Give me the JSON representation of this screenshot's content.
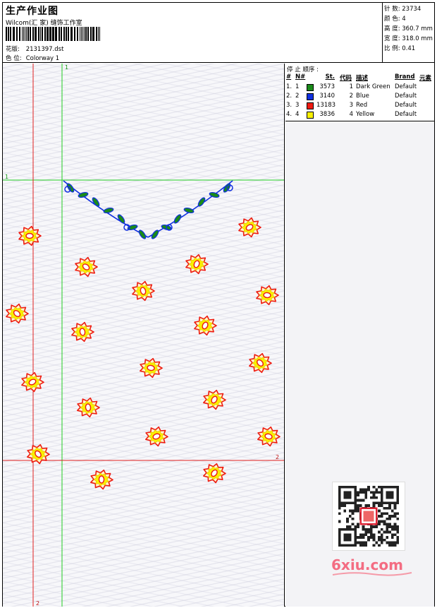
{
  "header": {
    "title": "生产作业图",
    "company": "Wilcom(汇 家) 缝饰工作室",
    "pattern_label": "花版:",
    "pattern_value": "2131397.dst",
    "color_label": "色 位:",
    "color_value": "Colorway 1"
  },
  "stats": {
    "stitches": "针 数: 23734",
    "colors": "颜 色: 4",
    "height": "高 度: 360.7 mm",
    "width": "宽 度: 318.0 mm",
    "scale": "比 例: 0.41"
  },
  "sequence": {
    "title": "停 止 顺序 :",
    "headers": {
      "n": "#",
      "no": "N#",
      "st": "St.",
      "code": "代码",
      "desc": "描述",
      "brand": "Brand",
      "elem": "元素"
    },
    "rows": [
      {
        "n": "1.",
        "no": "1",
        "color": "#1a8a1a",
        "st": "3573",
        "code": "1",
        "desc": "Dark Green",
        "brand": "Default"
      },
      {
        "n": "2.",
        "no": "2",
        "color": "#1030e0",
        "st": "3140",
        "code": "2",
        "desc": "Blue",
        "brand": "Default"
      },
      {
        "n": "3.",
        "no": "3",
        "color": "#ee1a10",
        "st": "13183",
        "code": "3",
        "desc": "Red",
        "brand": "Default"
      },
      {
        "n": "4.",
        "no": "4",
        "color": "#f8f000",
        "st": "3836",
        "code": "4",
        "desc": "Yellow",
        "brand": "Default"
      }
    ]
  },
  "guides": {
    "v1": "1",
    "h1": "1",
    "v2": "2",
    "h2": "2"
  },
  "colors": {
    "guide_green": "#22cc22",
    "guide_red": "#e02020",
    "flower_red": "#ee1a10",
    "flower_yellow": "#f8f000",
    "leaf_green": "#1a8a1a",
    "vine_blue": "#1030e0"
  },
  "watermark": "6xiu.com"
}
